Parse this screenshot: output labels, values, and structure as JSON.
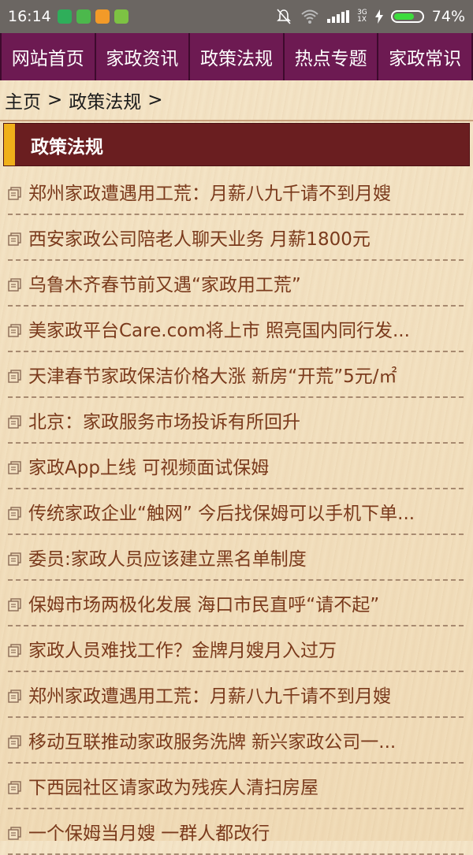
{
  "status_bar": {
    "time": "16:14",
    "battery_percent": "74%",
    "battery_level": 0.74,
    "network_top": "3G",
    "network_bottom": "1X",
    "notification_icons": [
      "shield-app-icon",
      "battery-app-icon",
      "orange-app-icon",
      "android-app-icon"
    ],
    "status_icons": [
      "mute-icon",
      "wifi-icon",
      "signal-icon",
      "charging-icon",
      "battery-icon"
    ]
  },
  "nav": {
    "tabs": [
      {
        "label": "网站首页"
      },
      {
        "label": "家政资讯"
      },
      {
        "label": "政策法规"
      },
      {
        "label": "热点专题"
      },
      {
        "label": "家政常识"
      }
    ]
  },
  "breadcrumb": {
    "home": "主页",
    "sep1": ">",
    "current": "政策法规",
    "sep2": ">"
  },
  "section": {
    "title": "政策法规"
  },
  "articles": [
    {
      "title": "郑州家政遭遇用工荒：月薪八九千请不到月嫂"
    },
    {
      "title": "西安家政公司陪老人聊天业务 月薪1800元"
    },
    {
      "title": "乌鲁木齐春节前又遇“家政用工荒”"
    },
    {
      "title": "美家政平台Care.com将上市 照亮国内同行发..."
    },
    {
      "title": "天津春节家政保洁价格大涨 新房“开荒”5元/㎡"
    },
    {
      "title": "北京：家政服务市场投诉有所回升"
    },
    {
      "title": "家政App上线 可视频面试保姆"
    },
    {
      "title": "传统家政企业“触网” 今后找保姆可以手机下单..."
    },
    {
      "title": "委员:家政人员应该建立黑名单制度"
    },
    {
      "title": "保姆市场两极化发展 海口市民直呼“请不起”"
    },
    {
      "title": "家政人员难找工作？金牌月嫂月入过万"
    },
    {
      "title": "郑州家政遭遇用工荒：月薪八九千请不到月嫂"
    },
    {
      "title": "移动互联推动家政服务洗牌 新兴家政公司一..."
    },
    {
      "title": "下西园社区请家政为残疾人清扫房屋"
    },
    {
      "title": "一个保姆当月嫂 一群人都改行"
    }
  ],
  "colors": {
    "nav_bg": "#6d1a52",
    "section_bg": "#6a1e20",
    "accent": "#f0b01a",
    "link": "#7a3a1c"
  }
}
